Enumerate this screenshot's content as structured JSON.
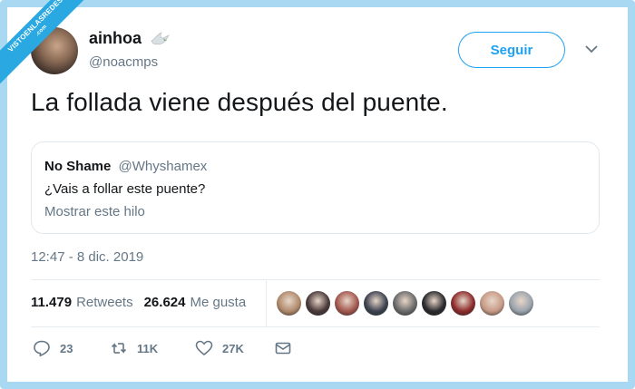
{
  "watermark": {
    "line1": "VISTOENLASREDES",
    "line2": ".com"
  },
  "author": {
    "display_name": "ainhoa",
    "handle": "@noacmps",
    "badge_icon": "dove-icon"
  },
  "header": {
    "follow_label": "Seguir",
    "menu_icon": "chevron-down-icon"
  },
  "tweet": {
    "text": "La follada viene después del puente."
  },
  "quoted_tweet": {
    "display_name": "No Shame",
    "handle": "@Whyshamex",
    "text": "¿Vais a follar este puente?",
    "thread_link": "Mostrar este hilo"
  },
  "timestamp": "12:47 - 8 dic. 2019",
  "stats": {
    "retweets_count": "11.479",
    "retweets_label": "Retweets",
    "likes_count": "26.624",
    "likes_label": "Me gusta"
  },
  "likers": [
    {
      "color": "#b08a6c"
    },
    {
      "color": "#4a3a3a"
    },
    {
      "color": "#a3574e"
    },
    {
      "color": "#3d4350"
    },
    {
      "color": "#6b6b6b"
    },
    {
      "color": "#2a2a2e"
    },
    {
      "color": "#8c2b2b"
    },
    {
      "color": "#c79a86"
    },
    {
      "color": "#9aa3ad"
    }
  ],
  "actions": {
    "reply_icon": "reply-icon",
    "reply_count": "23",
    "retweet_icon": "retweet-icon",
    "retweet_count": "11K",
    "like_icon": "heart-icon",
    "like_count": "27K",
    "dm_icon": "envelope-icon"
  },
  "colors": {
    "accent": "#1da1f2",
    "muted": "#657786",
    "border": "#e1e8ed",
    "frame": "#a9d8f2"
  }
}
